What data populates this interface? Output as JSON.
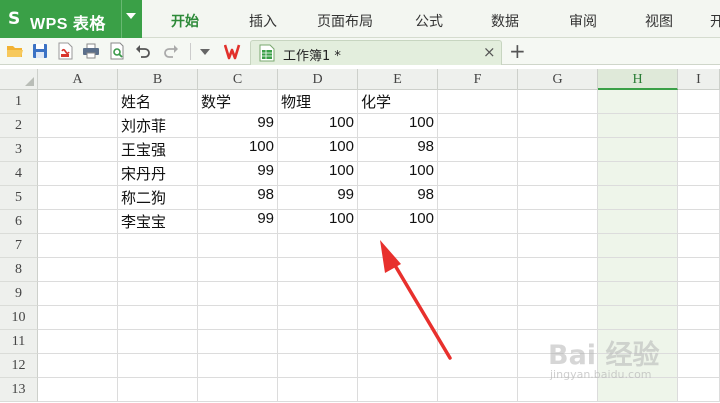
{
  "app": {
    "logo_glyph": "S",
    "title": "WPS 表格",
    "accent_color": "#3aa047"
  },
  "menu": {
    "tabs": [
      "开始",
      "插入",
      "页面布局",
      "公式",
      "数据",
      "审阅",
      "视图",
      "开"
    ],
    "active_index": 0
  },
  "toolbar": {
    "icons": [
      "open-folder-icon",
      "save-icon",
      "export-pdf-icon",
      "print-icon",
      "print-preview-icon",
      "undo-icon",
      "redo-icon",
      "more-dropdown-icon",
      "wps-logo-icon"
    ],
    "document_tab": {
      "title": "工作簿1 *",
      "close": "×"
    },
    "new_tab": "+"
  },
  "sheet": {
    "columns": [
      "A",
      "B",
      "C",
      "D",
      "E",
      "F",
      "G",
      "H",
      "I"
    ],
    "selected_column": "H",
    "rows": [
      "1",
      "2",
      "3",
      "4",
      "5",
      "6",
      "7",
      "8",
      "9",
      "10",
      "11",
      "12",
      "13"
    ],
    "table": {
      "headers": [
        "姓名",
        "数学",
        "物理",
        "化学"
      ],
      "records": [
        [
          "刘亦菲",
          "99",
          "100",
          "100"
        ],
        [
          "王宝强",
          "100",
          "100",
          "98"
        ],
        [
          "宋丹丹",
          "99",
          "100",
          "100"
        ],
        [
          "称二狗",
          "98",
          "99",
          "98"
        ],
        [
          "李宝宝",
          "99",
          "100",
          "100"
        ]
      ]
    }
  },
  "annotation": {
    "arrow_color": "#e8302d"
  },
  "watermark": {
    "text": "Bai 经验",
    "url": "jingyan.baidu.com"
  }
}
